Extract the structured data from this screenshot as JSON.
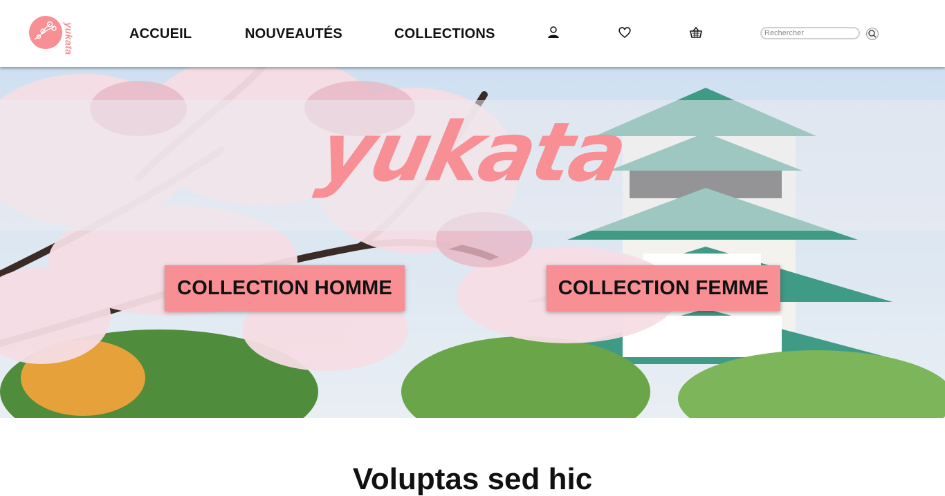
{
  "brand": {
    "logo_text": "yukata",
    "hero_title": "yukata"
  },
  "nav": {
    "items": [
      {
        "label": "ACCUEIL"
      },
      {
        "label": "NOUVEAUTÉS"
      },
      {
        "label": "COLLECTIONS"
      }
    ],
    "icons": [
      "user-icon",
      "heart-icon",
      "basket-icon"
    ]
  },
  "search": {
    "placeholder": "Rechercher",
    "button_icon": "search-icon"
  },
  "hero": {
    "cta_men": "COLLECTION HOMME",
    "cta_women": "COLLECTION FEMME"
  },
  "section": {
    "heading": "Voluptas  sed  hic"
  },
  "colors": {
    "accent": "#f88f95",
    "text": "#111111"
  }
}
